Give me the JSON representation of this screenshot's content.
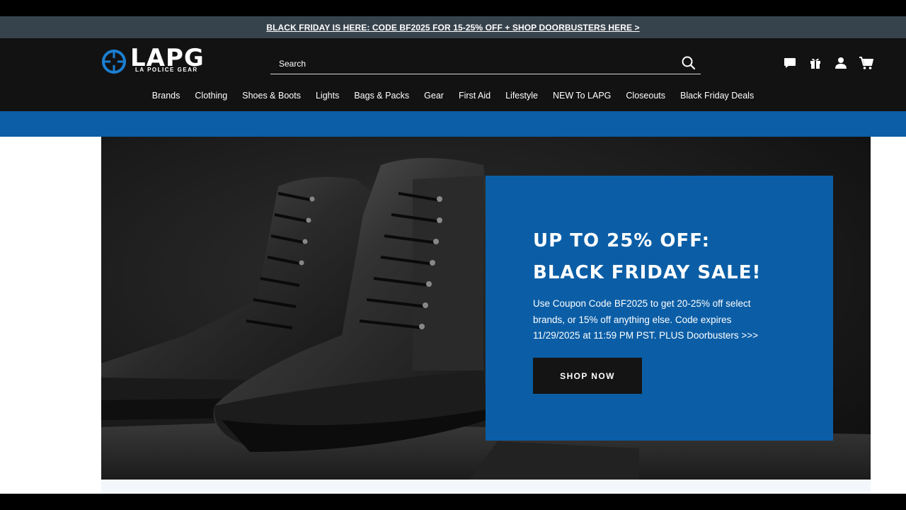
{
  "promo_bar": {
    "text": "BLACK FRIDAY IS HERE: CODE BF2025 FOR 15-25% OFF + SHOP DOORBUSTERS HERE >"
  },
  "logo": {
    "wordmark": "LAPG",
    "tagline": "LA POLICE GEAR"
  },
  "search": {
    "placeholder": "Search",
    "value": ""
  },
  "header_icons": [
    "chat-icon",
    "gift-icon",
    "account-icon",
    "cart-icon"
  ],
  "nav": {
    "items": [
      "Brands",
      "Clothing",
      "Shoes & Boots",
      "Lights",
      "Bags & Packs",
      "Gear",
      "First Aid",
      "Lifestyle",
      "NEW To LAPG",
      "Closeouts",
      "Black Friday Deals"
    ]
  },
  "hero": {
    "title_line1": "UP TO 25% OFF:",
    "title_line2": "BLACK FRIDAY SALE!",
    "body": "Use Coupon Code BF2025 to get 20-25% off select brands, or 15% off anything else. Code expires 11/29/2025 at 11:59 PM PST. PLUS Doorbusters >>>",
    "cta": "SHOP NOW"
  },
  "colors": {
    "promo_bar_bg": "#37434c",
    "header_bg": "#121212",
    "brand_blue": "#0c5ea6",
    "button_bg": "#141414"
  }
}
